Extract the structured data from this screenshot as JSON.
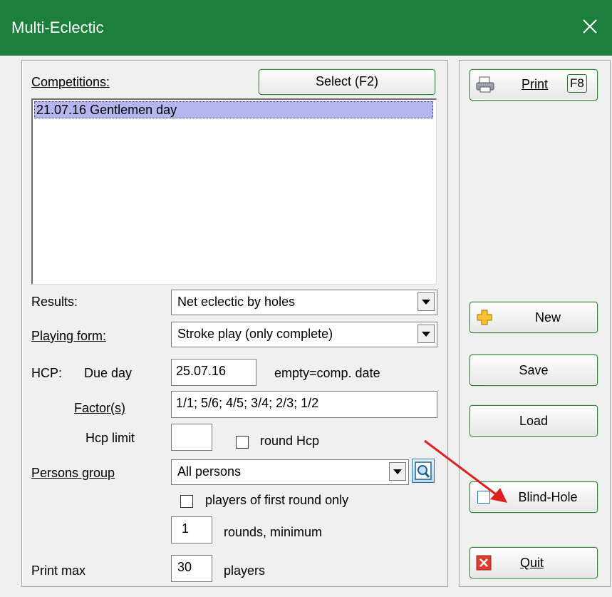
{
  "window": {
    "title": "Multi-Eclectic"
  },
  "competitions": {
    "label": "Competitions:",
    "select_button": "Select (F2)",
    "items": [
      "21.07.16 Gentlemen day"
    ]
  },
  "results": {
    "label": "Results:",
    "value": "Net eclectic by holes"
  },
  "playing_form": {
    "label": "Playing form:",
    "value": "Stroke play (only complete)"
  },
  "hcp": {
    "label": "HCP:",
    "due_day_label": "Due day",
    "due_day_value": "25.07.16",
    "due_day_hint": "empty=comp. date",
    "factors_label": "Factor(s)",
    "factors_value": "1/1; 5/6; 4/5; 3/4; 2/3; 1/2",
    "limit_label": "Hcp limit",
    "limit_value": "",
    "round_label": "round Hcp",
    "round_checked": false
  },
  "persons_group": {
    "label": "Persons group",
    "value": "All persons",
    "first_round_label": "players of first round only",
    "first_round_checked": false,
    "rounds_value": "1",
    "rounds_label": "rounds, minimum"
  },
  "print_max": {
    "label": "Print max",
    "value": "30",
    "unit": "players"
  },
  "side_buttons": {
    "print": "Print",
    "print_key": "F8",
    "new": "New",
    "save": "Save",
    "load": "Load",
    "blind_hole": "Blind-Hole",
    "blind_hole_checked": false,
    "quit": "Quit"
  },
  "colors": {
    "titlebar": "#1c7f3c",
    "selection": "#b5b5f0",
    "annotation_arrow": "#e02020"
  }
}
